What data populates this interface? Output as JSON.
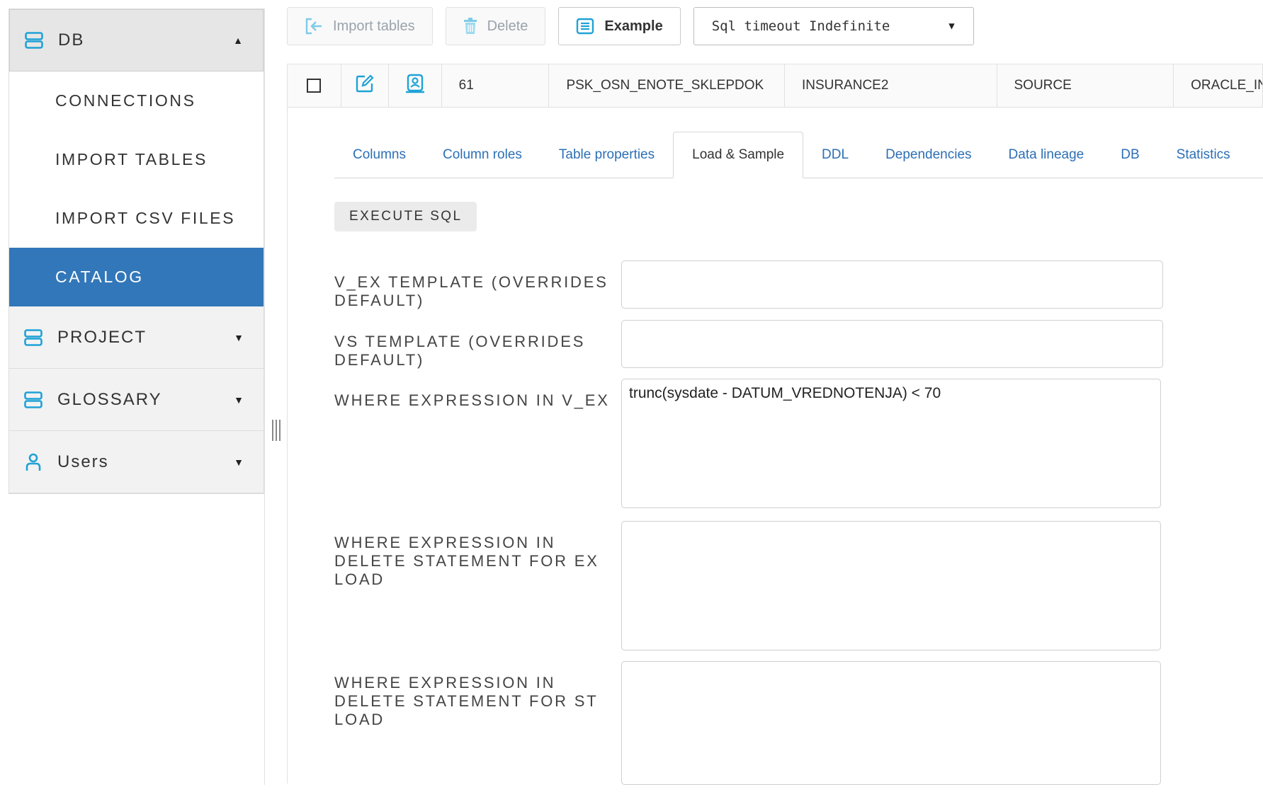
{
  "sidebar": {
    "groups": [
      {
        "label": "DB",
        "caret": "▲",
        "icon": "database-icon"
      },
      {
        "label": "PROJECT",
        "caret": "▼",
        "icon": "database-icon"
      },
      {
        "label": "GLOSSARY",
        "caret": "▼",
        "icon": "database-icon"
      },
      {
        "label": "Users",
        "caret": "▼",
        "icon": "user-icon"
      }
    ],
    "db_items": [
      "CONNECTIONS",
      "IMPORT TABLES",
      "IMPORT CSV FILES",
      "CATALOG"
    ],
    "active_item": "CATALOG"
  },
  "toolbar": {
    "import_label": "Import tables",
    "delete_label": "Delete",
    "example_label": "Example",
    "timeout_select": "Sql timeout Indefinite"
  },
  "row": {
    "id": "61",
    "table_name": "PSK_OSN_ENOTE_SKLEPDOK",
    "schema": "INSURANCE2",
    "type": "SOURCE",
    "connection": "ORACLE_IN"
  },
  "tabs": [
    "Columns",
    "Column roles",
    "Table properties",
    "Load & Sample",
    "DDL",
    "Dependencies",
    "Data lineage",
    "DB",
    "Statistics"
  ],
  "active_tab": "Load & Sample",
  "execute_label": "EXECUTE SQL",
  "form": {
    "vex_template_label": "V_EX TEMPLATE (OVERRIDES DEFAULT)",
    "vex_template_value": "",
    "vs_template_label": "VS TEMPLATE (OVERRIDES DEFAULT)",
    "vs_template_value": "",
    "where_vex_label": "WHERE EXPRESSION IN V_EX",
    "where_vex_value": "trunc(sysdate - DATUM_VREDNOTENJA) < 70",
    "where_delete_ex_label": "WHERE EXPRESSION IN DELETE STATEMENT FOR EX LOAD",
    "where_delete_ex_value": "",
    "where_delete_st_label": "WHERE EXPRESSION IN DELETE STATEMENT FOR ST LOAD",
    "where_delete_st_value": ""
  },
  "colors": {
    "accent": "#3277b9",
    "icon_blue": "#1fa2d6",
    "link": "#2c6fb5"
  }
}
